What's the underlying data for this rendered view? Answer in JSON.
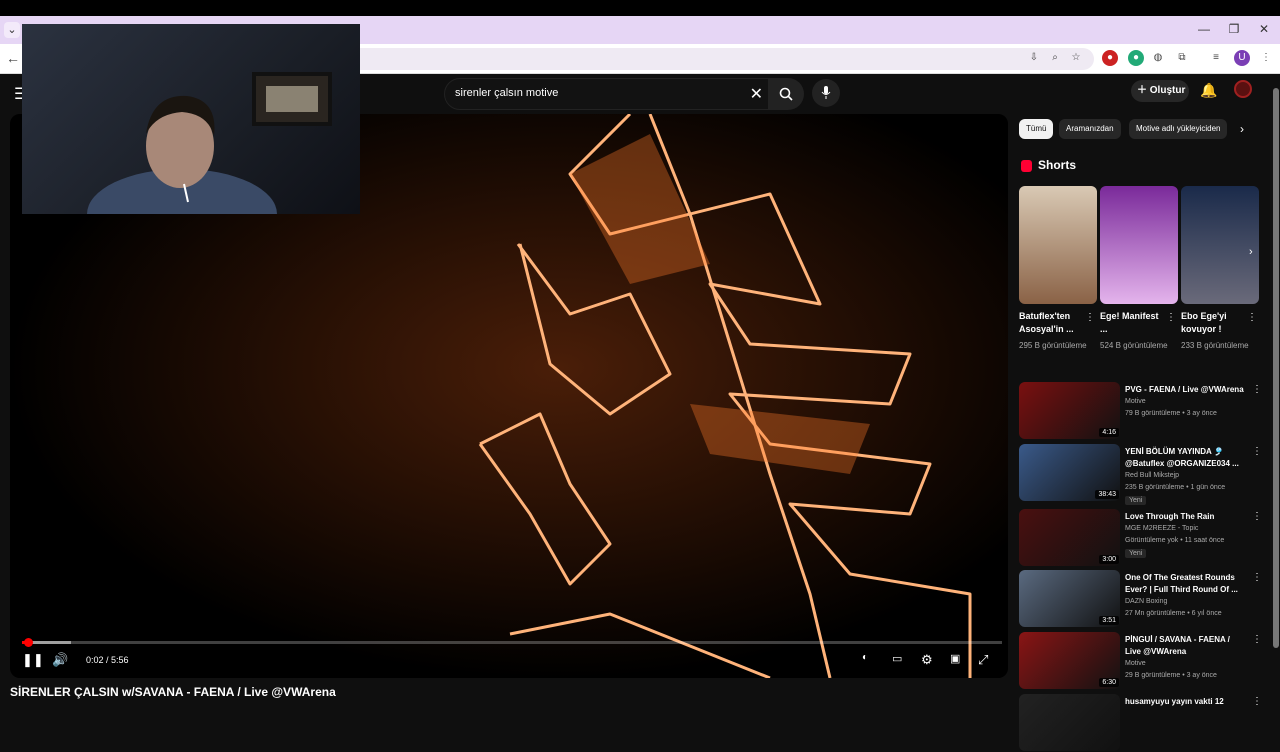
{
  "browser": {
    "omnibox_value": ""
  },
  "header": {
    "search_query": "sirenler çalsın motive",
    "create_label": "Oluştur"
  },
  "player": {
    "time": "0:02 / 5:56",
    "progress_played": 0.006,
    "progress_loaded": 0.05
  },
  "video_title": "SİRENLER ÇALSIN w/SAVANA - FAENA / Live @VWArena",
  "chips": [
    "Tümü",
    "Aramanızdan",
    "Motive adlı yükleyiciden"
  ],
  "shorts": {
    "heading": "Shorts",
    "items": [
      {
        "title": "Batuflex'ten Asosyal'in ...",
        "views": "295 B görüntüleme",
        "color": "#b07a5a"
      },
      {
        "title": "Ege! Manifest ...",
        "views": "524 B görüntüleme",
        "color": "#c58fd8"
      },
      {
        "title": "Ebo Ege'yi kovuyor !",
        "views": "233 B görüntüleme",
        "color": "#3a4560"
      }
    ]
  },
  "recommendations": [
    {
      "title": "PVG - FAENA / Live @VWArena",
      "channel": "Motive",
      "meta": "79 B görüntüleme • 3 ay önce",
      "duration": "4:16",
      "badge": "",
      "color": "#7a1010"
    },
    {
      "title": "YENİ BÖLÜM YAYINDA 🎐 @Batuflex @ORGANIZE034 ...",
      "channel": "Red Bull Mikstejp",
      "meta": "235 B görüntüleme • 1 gün önce",
      "duration": "38:43",
      "badge": "Yeni",
      "color": "#3a5a8a"
    },
    {
      "title": "Love Through The Rain",
      "channel": "MGE M2REEZE - Topic",
      "meta": "Görüntüleme yok • 11 saat önce",
      "duration": "3:00",
      "badge": "Yeni",
      "color": "#4a1010"
    },
    {
      "title": "One Of The Greatest Rounds Ever? | Full Third Round Of ...",
      "channel": "DAZN Boxing",
      "meta": "27 Mn görüntüleme • 6 yıl önce",
      "duration": "3:51",
      "badge": "",
      "color": "#5a6a80"
    },
    {
      "title": "PİNGUİ / SAVANA - FAENA / Live @VWArena",
      "channel": "Motive",
      "meta": "29 B görüntüleme • 3 ay önce",
      "duration": "6:30",
      "badge": "",
      "color": "#8a1515"
    },
    {
      "title": "husamyuyu yayın vakti 12",
      "channel": "",
      "meta": "",
      "duration": "",
      "badge": "",
      "color": "#222"
    }
  ]
}
